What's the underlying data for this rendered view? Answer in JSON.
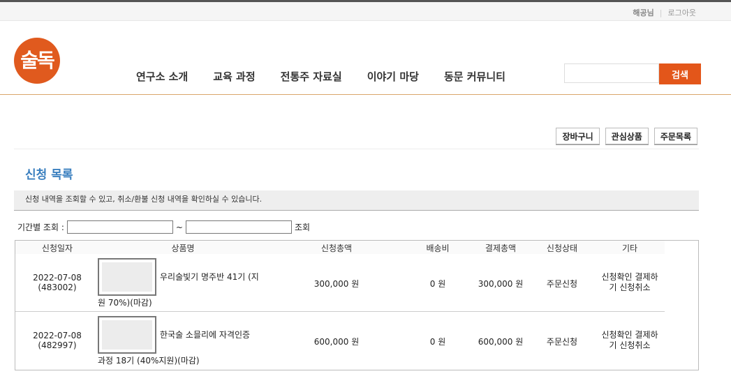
{
  "util": {
    "user": "해공님",
    "logout": "로그아웃"
  },
  "logo": {
    "text": "술독"
  },
  "nav": [
    "연구소 소개",
    "교육 과정",
    "전통주 자료실",
    "이야기 마당",
    "동문 커뮤니티"
  ],
  "search": {
    "button": "검색",
    "placeholder": ""
  },
  "tools": [
    "장바구니",
    "관심상품",
    "주문목록"
  ],
  "page_title": "신청 목록",
  "notice": "신청 내역을 조회할 수 있고, 취소/환불 신청 내역을 확인하실 수 있습니다.",
  "period": {
    "label": "기간별 조회 :",
    "tilde": "~",
    "search": "조회",
    "from": "",
    "to": ""
  },
  "table": {
    "headers": [
      "신청일자",
      "상품명",
      "신청총액",
      "배송비",
      "결제총액",
      "신청상태",
      "기타"
    ],
    "rows": [
      {
        "date": "2022-07-08",
        "order_no": "(483002)",
        "name_line1": "우리술빛기 명주반 41기 (지",
        "name_line2": "원 70%)(마감)",
        "amount": "300,000 원",
        "shipping": "0 원",
        "total": "300,000 원",
        "status": "주문신청",
        "etc_line1": "신청확인 결제하",
        "etc_line2": "기 신청취소"
      },
      {
        "date": "2022-07-08",
        "order_no": "(482997)",
        "name_line1": "한국술 소믈리에 자격인증",
        "name_line2": "과정 18기 (40%지원)(마감)",
        "amount": "600,000 원",
        "shipping": "0 원",
        "total": "600,000 원",
        "status": "주문신청",
        "etc_line1": "신청확인 결제하",
        "etc_line2": "기 신청취소"
      }
    ]
  },
  "colors": {
    "accent": "#e3561a",
    "title": "#3a7fbf"
  }
}
